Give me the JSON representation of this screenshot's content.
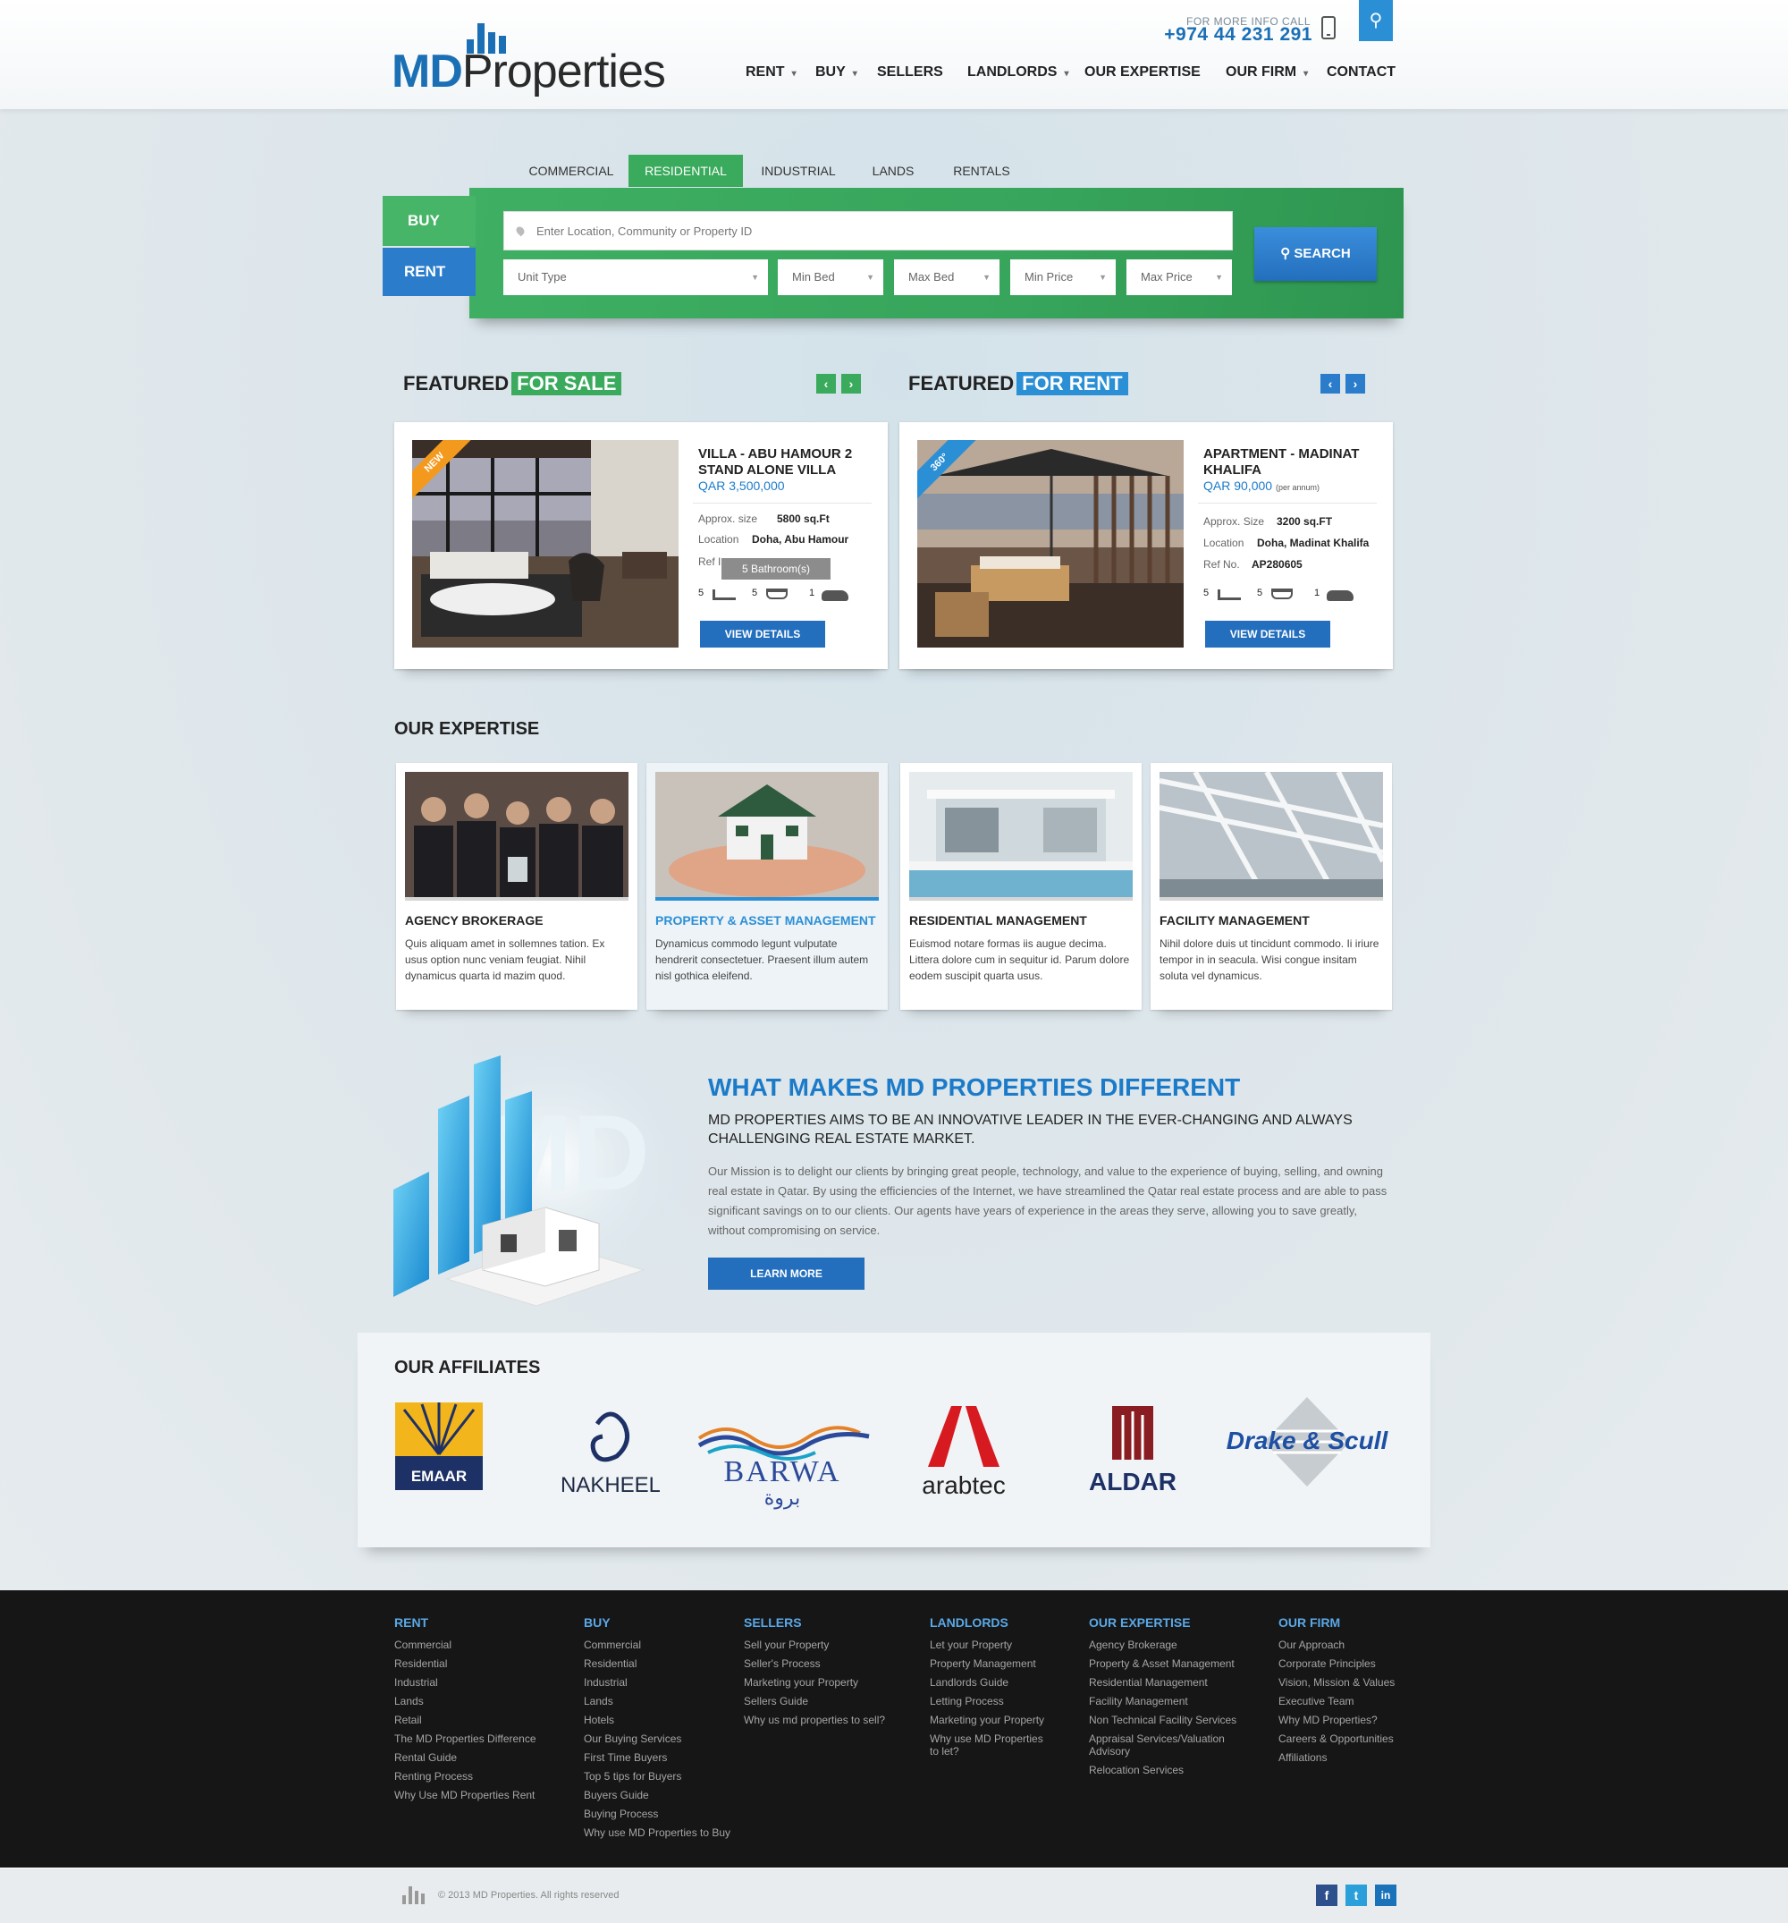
{
  "header": {
    "logo_md": "MD",
    "logo_properties": "Properties",
    "info_label": "FOR MORE INFO CALL",
    "phone": "+974 44 231 291",
    "nav": [
      {
        "label": "RENT",
        "dropdown": true
      },
      {
        "label": "BUY",
        "dropdown": true
      },
      {
        "label": "SELLERS",
        "dropdown": false
      },
      {
        "label": "LANDLORDS",
        "dropdown": true
      },
      {
        "label": "OUR EXPERTISE",
        "dropdown": false
      },
      {
        "label": "OUR FIRM",
        "dropdown": true
      },
      {
        "label": "CONTACT",
        "dropdown": false
      }
    ]
  },
  "search": {
    "tabs": [
      "COMMERCIAL",
      "RESIDENTIAL",
      "INDUSTRIAL",
      "LANDS",
      "RENTALS"
    ],
    "active_tab": "RESIDENTIAL",
    "buy_label": "BUY",
    "rent_label": "RENT",
    "placeholder": "Enter Location, Community or Property ID",
    "selects": [
      "Unit Type",
      "Min Bed",
      "Max Bed",
      "Min Price",
      "Max Price"
    ],
    "button_label": "SEARCH"
  },
  "featured": {
    "sale": {
      "title": "FEATURED",
      "badge": "FOR SALE",
      "ribbon": "NEW",
      "name": "VILLA - ABU HAMOUR 2 STAND ALONE VILLA",
      "price": "QAR 3,500,000",
      "size_label": "Approx. size",
      "size_value": "5800 sq.Ft",
      "location_label": "Location",
      "location_value": "Doha, Abu Hamour",
      "ref_label": "Ref I",
      "tooltip": "5 Bathroom(s)",
      "beds": "5",
      "baths": "5",
      "cars": "1",
      "button": "VIEW DETAILS"
    },
    "rent": {
      "title": "FEATURED",
      "badge": "FOR RENT",
      "ribbon": "360°",
      "name": "APARTMENT - MADINAT KHALIFA",
      "price": "QAR 90,000",
      "price_note": "(per annum)",
      "size_label": "Approx. Size",
      "size_value": "3200 sq.FT",
      "location_label": "Location",
      "location_value": "Doha, Madinat Khalifa",
      "ref_label": "Ref No.",
      "ref_value": "AP280605",
      "beds": "5",
      "baths": "5",
      "cars": "1",
      "button": "VIEW DETAILS"
    }
  },
  "expertise": {
    "title": "OUR EXPERTISE",
    "items": [
      {
        "title": "AGENCY BROKERAGE",
        "text": "Quis aliquam amet in sollemnes tation. Ex usus option nunc veniam feugiat. Nihil dynamicus quarta id mazim quod."
      },
      {
        "title": "PROPERTY & ASSET MANAGEMENT",
        "text": "Dynamicus commodo legunt vulputate hendrerit consectetuer. Praesent illum autem nisl gothica eleifend."
      },
      {
        "title": "RESIDENTIAL MANAGEMENT",
        "text": "Euismod notare formas iis augue decima. Littera dolore cum in sequitur id. Parum dolore eodem suscipit quarta usus."
      },
      {
        "title": "FACILITY MANAGEMENT",
        "text": "Nihil dolore duis ut tincidunt commodo. Ii iriure tempor in in seacula. Wisi congue insitam soluta vel dynamicus."
      }
    ]
  },
  "different": {
    "title": "WHAT MAKES MD PROPERTIES DIFFERENT",
    "subtitle": "MD PROPERTIES AIMS TO BE AN INNOVATIVE LEADER IN THE EVER-CHANGING AND ALWAYS CHALLENGING REAL ESTATE MARKET.",
    "text": "Our Mission is to delight our clients by bringing great people, technology, and value to the experience of buying, selling, and owning real estate in Qatar. By using the efficiencies of the Internet, we have streamlined the Qatar real estate process and are able to pass significant savings on to our clients. Our agents have years of experience in the areas they serve, allowing you to save greatly, without compromising on service.",
    "button": "LEARN MORE",
    "art_letters": "MD"
  },
  "affiliates": {
    "title": "OUR AFFILIATES",
    "logos": [
      "EMAAR",
      "NAKHEEL",
      "BARWA",
      "arabtec",
      "ALDAR",
      "Drake & Scull"
    ],
    "barwa_arabic": "بروة"
  },
  "footer": {
    "columns": [
      {
        "title": "RENT",
        "links": [
          "Commercial",
          "Residential",
          "Industrial",
          "Lands",
          "Retail",
          "The MD Properties Difference",
          "Rental Guide",
          "Renting Process",
          "Why Use MD Properties Rent"
        ]
      },
      {
        "title": "BUY",
        "links": [
          "Commercial",
          "Residential",
          "Industrial",
          "Lands",
          "Hotels",
          "Our Buying Services",
          "First Time Buyers",
          "Top 5 tips for Buyers",
          "Buyers Guide",
          "Buying Process",
          "Why use MD Properties to Buy"
        ]
      },
      {
        "title": "SELLERS",
        "links": [
          "Sell your Property",
          "Seller's Process",
          "Marketing your Property",
          "Sellers Guide",
          "Why us md properties to sell?"
        ]
      },
      {
        "title": "LANDLORDS",
        "links": [
          "Let your Property",
          "Property Management",
          "Landlords Guide",
          "Letting Process",
          "Marketing your Property",
          "Why use MD Properties",
          "to let?"
        ]
      },
      {
        "title": "OUR EXPERTISE",
        "links": [
          "Agency Brokerage",
          "Property & Asset Management",
          "Residential Management",
          "Facility Management",
          "Non Technical Facility Services",
          "Appraisal Services/Valuation",
          "Advisory",
          "Relocation Services"
        ]
      },
      {
        "title": "OUR FIRM",
        "links": [
          "Our Approach",
          "Corporate Principles",
          "Vision, Mission & Values",
          "Executive Team",
          "Why MD Properties?",
          "Careers & Opportunities",
          "Affiliations"
        ]
      }
    ],
    "copyright": "© 2013 MD Properties. All rights reserved",
    "social": [
      "f",
      "t",
      "in"
    ]
  },
  "colors": {
    "brand_blue": "#1b6fb5",
    "green": "#3aaa5c",
    "footer_bg": "#161616",
    "link_blue": "#5ba8e6"
  }
}
